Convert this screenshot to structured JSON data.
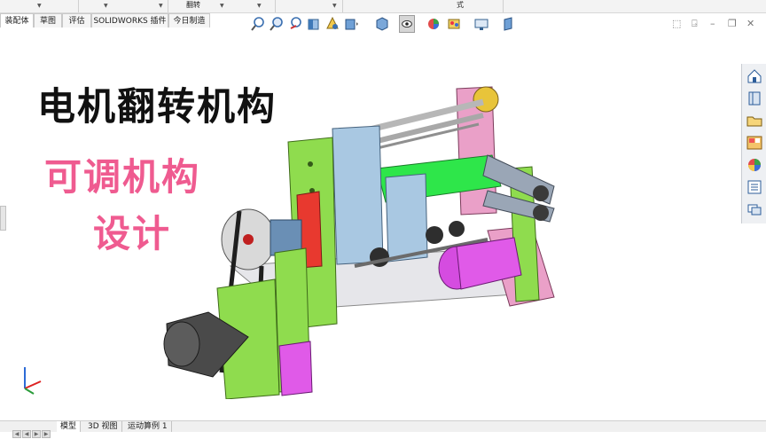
{
  "top_strip": {
    "label_partial_a": "翻转",
    "label_partial_b": "式"
  },
  "command_tabs": [
    {
      "label": "装配体",
      "active": true
    },
    {
      "label": "草图",
      "active": false
    },
    {
      "label": "评估",
      "active": false
    },
    {
      "label": "SOLIDWORKS 插件",
      "active": false
    },
    {
      "label": "今日制造",
      "active": false
    }
  ],
  "heads_up_toolbar": {
    "icons": [
      "zoom-to-fit-icon",
      "zoom-area-icon",
      "previous-view-icon",
      "section-view-icon",
      "dynamic-annotation-icon",
      "view-orientation-icon",
      "display-style-icon",
      "hide-show-items-icon",
      "edit-appearance-icon",
      "apply-scene-icon",
      "view-settings-icon",
      "rotate-view-icon"
    ]
  },
  "window_controls": {
    "icons": [
      "expand-icon",
      "pin-icon",
      "restore-icon",
      "close-icon"
    ]
  },
  "task_pane": {
    "icons": [
      "solidworks-resources-icon",
      "design-library-icon",
      "file-explorer-icon",
      "view-palette-icon",
      "appearances-icon",
      "custom-properties-icon",
      "forum-icon"
    ]
  },
  "overlay_text": {
    "line1": "电机翻转机构",
    "line2": "可调机构",
    "line3": "设计"
  },
  "bottom_tabs": [
    {
      "label": "模型",
      "active": true
    },
    {
      "label": "3D 视图",
      "active": false
    },
    {
      "label": "运动算例 1",
      "active": false
    }
  ],
  "colors": {
    "accent_pink": "#ef5b90",
    "frame_green": "#8fdc4e",
    "motor_magenta": "#e05ae8",
    "bracket_pink": "#eaa0c8"
  }
}
